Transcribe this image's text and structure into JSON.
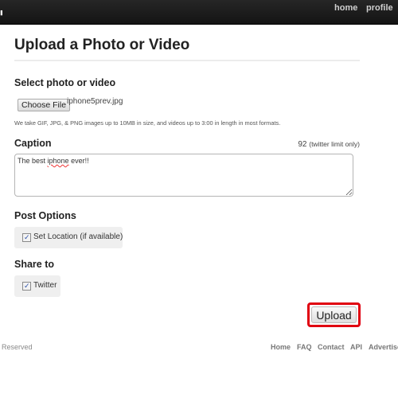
{
  "navbar": {
    "links": [
      {
        "label": "home"
      },
      {
        "label": "profile"
      }
    ]
  },
  "page": {
    "title": "Upload a Photo or Video"
  },
  "select": {
    "label": "Select photo or video",
    "button_label": "Choose File",
    "file_name": "iphone5prev.jpg",
    "hint": "We take GIF, JPG, & PNG images up to 10MB in size, and videos up to 3:00 in length in most formats."
  },
  "caption": {
    "label": "Caption",
    "remaining": "92",
    "limit_note": "(twitter limit only)",
    "value_before": "The best ",
    "value_misspelled": "iphone",
    "value_after": " ever!!"
  },
  "post_options": {
    "label": "Post Options",
    "items": [
      {
        "label": "Set Location (if available)",
        "checked": true
      }
    ]
  },
  "share": {
    "label": "Share to",
    "items": [
      {
        "label": "Twitter",
        "checked": true
      }
    ]
  },
  "actions": {
    "upload_label": "Upload",
    "highlight_color": "#e00010"
  },
  "footer": {
    "left_text": "Reserved",
    "links": [
      {
        "label": "Home"
      },
      {
        "label": "FAQ"
      },
      {
        "label": "Contact"
      },
      {
        "label": "API"
      },
      {
        "label": "Advertise"
      }
    ]
  }
}
